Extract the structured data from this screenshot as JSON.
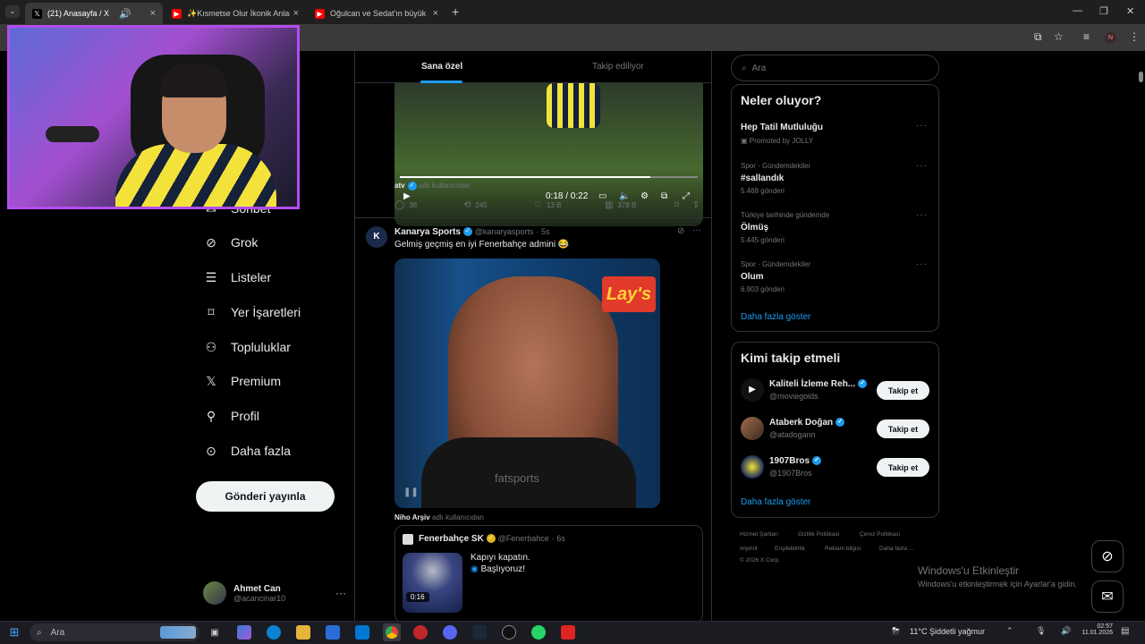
{
  "browser": {
    "tabs": [
      {
        "label": "(21) Anasayfa / X"
      },
      {
        "label": "✨Kısmetse Olur İkonik Anlar✨"
      },
      {
        "label": "Oğulcan ve Sedat'ın büyük kav"
      }
    ],
    "profile_initial": "N"
  },
  "nav": {
    "items": [
      {
        "label": "Sohbet",
        "icon": "chat-icon"
      },
      {
        "label": "Grok",
        "icon": "grok-icon"
      },
      {
        "label": "Listeler",
        "icon": "list-icon"
      },
      {
        "label": "Yer İşaretleri",
        "icon": "bookmark-icon"
      },
      {
        "label": "Topluluklar",
        "icon": "communities-icon"
      },
      {
        "label": "Premium",
        "icon": "x-logo-icon"
      },
      {
        "label": "Profil",
        "icon": "person-icon"
      },
      {
        "label": "Daha fazla",
        "icon": "more-circle-icon"
      }
    ],
    "post_button": "Gönderi yayınla",
    "account": {
      "name": "Ahmet Can",
      "handle": "@acancinar10"
    }
  },
  "feed": {
    "tabs": [
      "Sana özel",
      "Takip ediliyor"
    ],
    "active_tab": 0,
    "video1": {
      "time": "0:18 / 0:22",
      "progress": 0.84,
      "credit_user": "atv",
      "credit_suffix": "adlı kullanıcıdan",
      "stats": {
        "replies": "38",
        "reposts": "245",
        "likes": "13 B",
        "views": "378 B"
      }
    },
    "post2": {
      "author": "Kanarya Sports",
      "handle": "@kanaryasports",
      "time": "5s",
      "text": "Gelmiş geçmiş en iyi Fenerbahçe admini 😂",
      "watermark": "fatsports",
      "sponsor_text": "Lay's",
      "credit_user": "Niho Arşiv",
      "credit_suffix": "adlı kullanıcıdan"
    },
    "quoted": {
      "author": "Fenerbahçe SK",
      "handle": "@Fenerbahce",
      "time": "6s",
      "line1": "Kapıyı kapatın.",
      "line2": "Başlıyoruz!",
      "duration": "0:16"
    }
  },
  "sidebar": {
    "search_placeholder": "Ara",
    "trends_title": "Neler oluyor?",
    "trends": [
      {
        "category": "",
        "name": "Hep Tatil Mutluluğu",
        "sub": "Promoted by JOLLY"
      },
      {
        "category": "Spor · Gündemdekiler",
        "name": "#sallandık",
        "sub": "5.468 gönderi"
      },
      {
        "category": "Türkiye tarihinde gündemde",
        "name": "Ölmüş",
        "sub": "5.445 gönderi"
      },
      {
        "category": "Spor · Gündemdekiler",
        "name": "Olum",
        "sub": "6.903 gönderi"
      }
    ],
    "trends_more": "Daha fazla göster",
    "who_title": "Kimi takip etmeli",
    "who": [
      {
        "name": "Kaliteli İzleme Reh...",
        "handle": "@moviegolds",
        "button": "Takip et"
      },
      {
        "name": "Ataberk Doğan",
        "handle": "@atadogann",
        "button": "Takip et"
      },
      {
        "name": "1907Bros",
        "handle": "@1907Bros",
        "button": "Takip et"
      }
    ],
    "who_more": "Daha fazla göster",
    "footer": [
      "Hizmet Şartları",
      "Gizlilik Politikası",
      "Çerez Politikası",
      "Imprint",
      "Erişilebilirlik",
      "Reklam bilgisi",
      "Daha fazla ...",
      "© 2026 X Corp."
    ]
  },
  "activation": {
    "title": "Windows'u Etkinleştir",
    "text": "Windows'u etkinleştirmek için Ayarlar'a gidin."
  },
  "taskbar": {
    "search": "Ara",
    "weather": "11°C  Şiddetli yağmur",
    "time": "02:57",
    "date": "11.01.2026"
  },
  "colors": {
    "accent": "#1d9bf0",
    "webcam_border": "#b44cf0",
    "gold": "#e2b719"
  }
}
